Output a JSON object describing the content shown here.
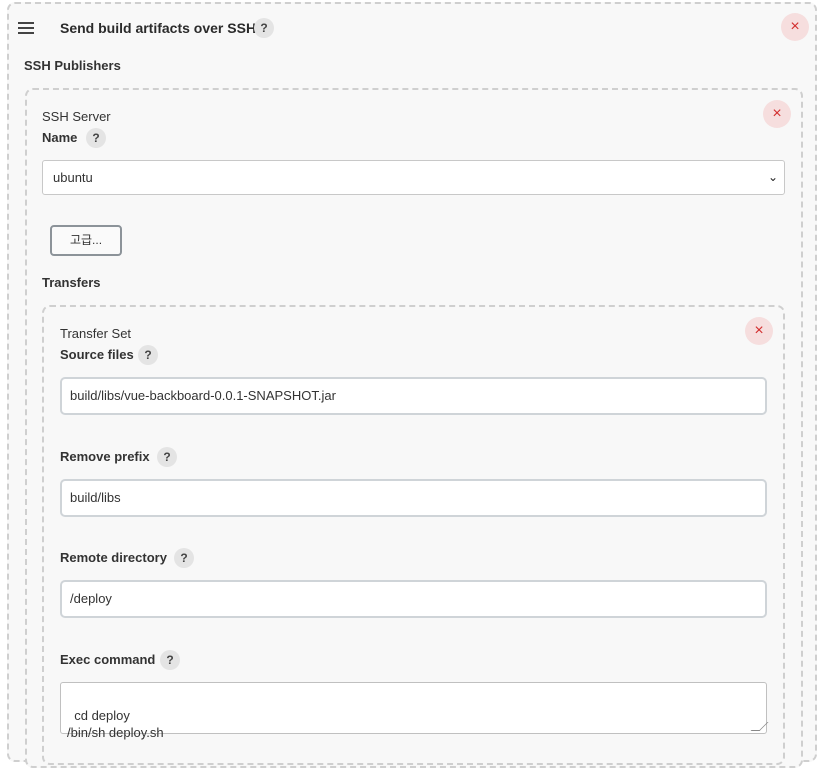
{
  "section": {
    "title": "Send build artifacts over SSH",
    "help_glyph": "?",
    "close_glyph": "×",
    "ssh_publishers_label": "SSH Publishers"
  },
  "ssh_server": {
    "heading": "SSH Server",
    "name_label": "Name",
    "name_value": "ubuntu",
    "advanced_button": "고급...",
    "transfers_label": "Transfers"
  },
  "transfer_set": {
    "heading": "Transfer Set",
    "source_files_label": "Source files",
    "source_files_value": "build/libs/vue-backboard-0.0.1-SNAPSHOT.jar",
    "remove_prefix_label": "Remove prefix",
    "remove_prefix_value": "build/libs",
    "remote_directory_label": "Remote directory",
    "remote_directory_value": "/deploy",
    "exec_command_label": "Exec command",
    "exec_command_value": "cd deploy\n/bin/sh deploy.sh"
  },
  "icons": {
    "menu": "hamburger-icon",
    "help": "help-icon",
    "close": "close-icon",
    "dropdown": "chevron-down-icon"
  },
  "colors": {
    "close_bg": "#f6dede",
    "close_fg": "#d22d2d",
    "panel_bg": "#f8f8f8"
  }
}
